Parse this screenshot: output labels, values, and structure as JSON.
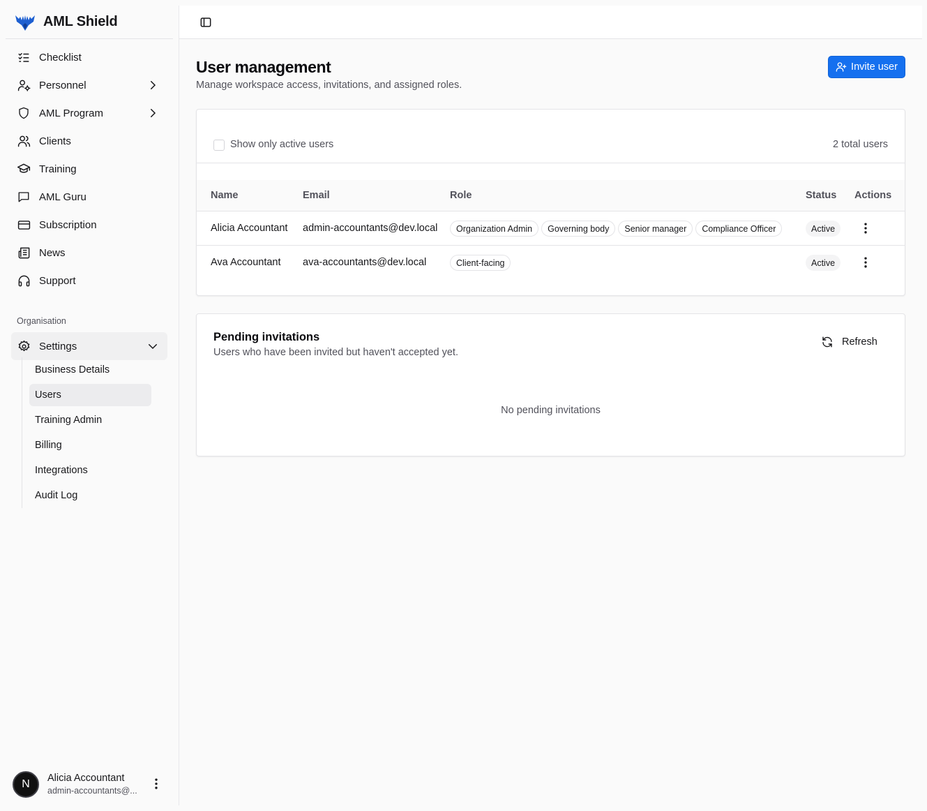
{
  "brand": {
    "name": "AML Shield"
  },
  "sidebar": {
    "items": [
      {
        "label": "Checklist",
        "icon": "checklist-icon"
      },
      {
        "label": "Personnel",
        "icon": "user-cog-icon",
        "has_chevron": true
      },
      {
        "label": "AML Program",
        "icon": "shield-icon",
        "has_chevron": true
      },
      {
        "label": "Clients",
        "icon": "users-icon"
      },
      {
        "label": "Training",
        "icon": "graduation-cap-icon"
      },
      {
        "label": "AML Guru",
        "icon": "message-square-icon"
      },
      {
        "label": "Subscription",
        "icon": "credit-card-icon"
      },
      {
        "label": "News",
        "icon": "newspaper-icon"
      },
      {
        "label": "Support",
        "icon": "headphones-icon"
      }
    ],
    "section_label": "Organisation",
    "settings_label": "Settings",
    "settings_items": [
      {
        "label": "Business Details"
      },
      {
        "label": "Users",
        "active": true
      },
      {
        "label": "Training Admin"
      },
      {
        "label": "Billing"
      },
      {
        "label": "Integrations"
      },
      {
        "label": "Audit Log"
      }
    ]
  },
  "user": {
    "initial": "N",
    "name": "Alicia Accountant",
    "email": "admin-accountants@..."
  },
  "page": {
    "title": "User management",
    "subtitle": "Manage workspace access, invitations, and assigned roles.",
    "invite_label": "Invite user"
  },
  "users_table": {
    "filter_label": "Show only active users",
    "filter_checked": false,
    "total_label": "2 total users",
    "headers": {
      "name": "Name",
      "email": "Email",
      "role": "Role",
      "status": "Status",
      "actions": "Actions"
    },
    "rows": [
      {
        "name": "Alicia Accountant",
        "email": "admin-accountants@dev.local",
        "roles": [
          "Organization Admin",
          "Governing body",
          "Senior manager",
          "Compliance Officer"
        ],
        "status": "Active"
      },
      {
        "name": "Ava Accountant",
        "email": "ava-accountants@dev.local",
        "roles": [
          "Client-facing"
        ],
        "status": "Active"
      }
    ]
  },
  "pending": {
    "title": "Pending invitations",
    "subtitle": "Users who have been invited but haven't accepted yet.",
    "refresh_label": "Refresh",
    "empty_text": "No pending invitations"
  },
  "colors": {
    "accent": "#1570ef",
    "text": "#18181b",
    "muted": "#52525b",
    "border": "#e4e4e7"
  }
}
